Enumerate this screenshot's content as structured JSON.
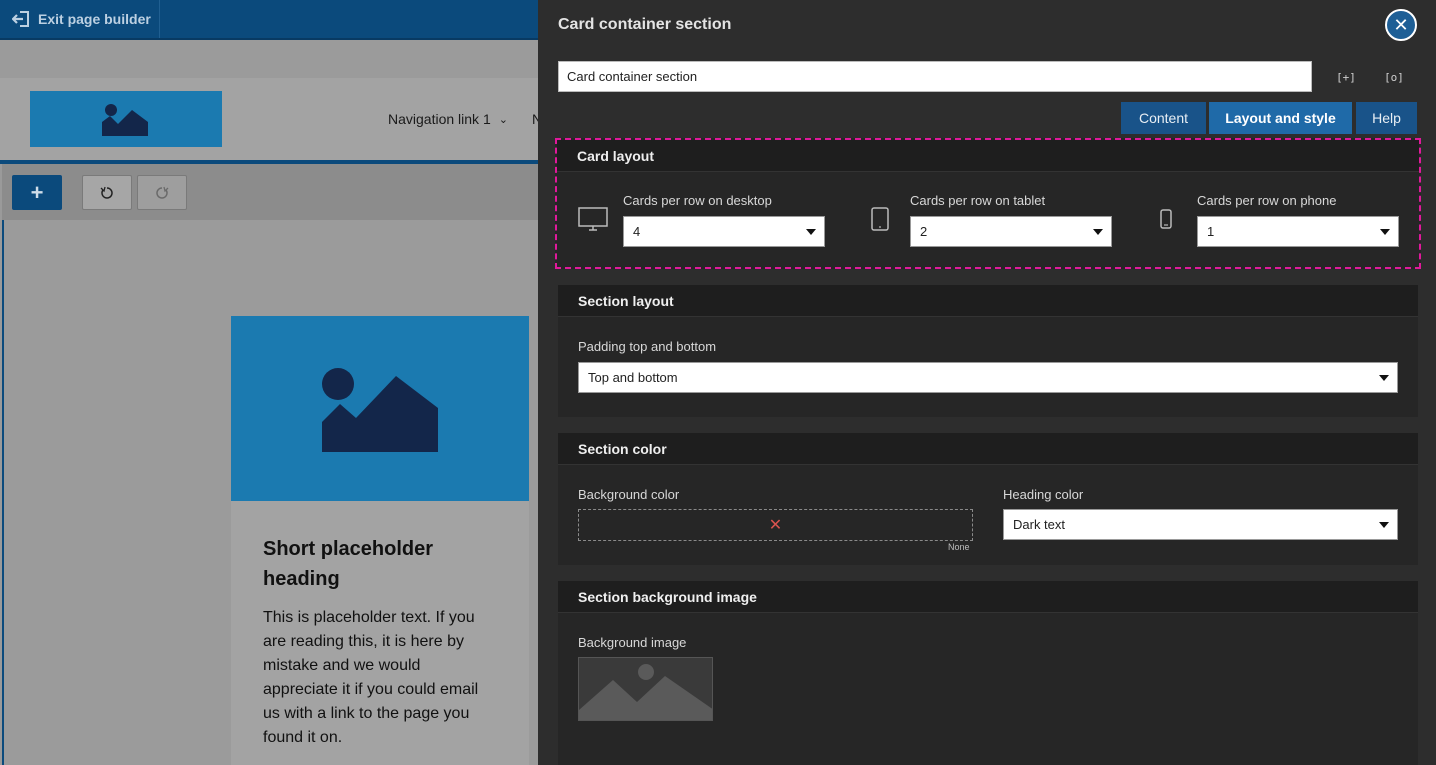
{
  "topbar": {
    "exit_label": "Exit page builder"
  },
  "site": {
    "nav": [
      {
        "label": "Navigation link 1"
      },
      {
        "label": "N"
      }
    ]
  },
  "toolbar": {
    "add_label": "+"
  },
  "card": {
    "heading": "Short placeholder heading",
    "body": "This is placeholder text. If you are reading this, it is here by mistake and we would appreciate it if you could email us with a link to the page you found it on."
  },
  "panel": {
    "title": "Card container section",
    "name_value": "Card container section",
    "tabs": [
      {
        "label": "Content"
      },
      {
        "label": "Layout and style"
      },
      {
        "label": "Help"
      }
    ]
  },
  "card_layout": {
    "heading": "Card layout",
    "desktop_label": "Cards per row on desktop",
    "desktop_value": "4",
    "tablet_label": "Cards per row on tablet",
    "tablet_value": "2",
    "phone_label": "Cards per row on phone",
    "phone_value": "1"
  },
  "section_layout": {
    "heading": "Section layout",
    "padding_label": "Padding top and bottom",
    "padding_value": "Top and bottom"
  },
  "section_color": {
    "heading": "Section color",
    "bg_label": "Background color",
    "bg_none": "None",
    "heading_color_label": "Heading color",
    "heading_color_value": "Dark text"
  },
  "section_bg_image": {
    "heading": "Section background image",
    "image_label": "Background image"
  },
  "colors": {
    "brand_blue": "#1f6aa8",
    "highlight_dash": "#e0199b",
    "panel_bg": "#2d2d2d"
  }
}
